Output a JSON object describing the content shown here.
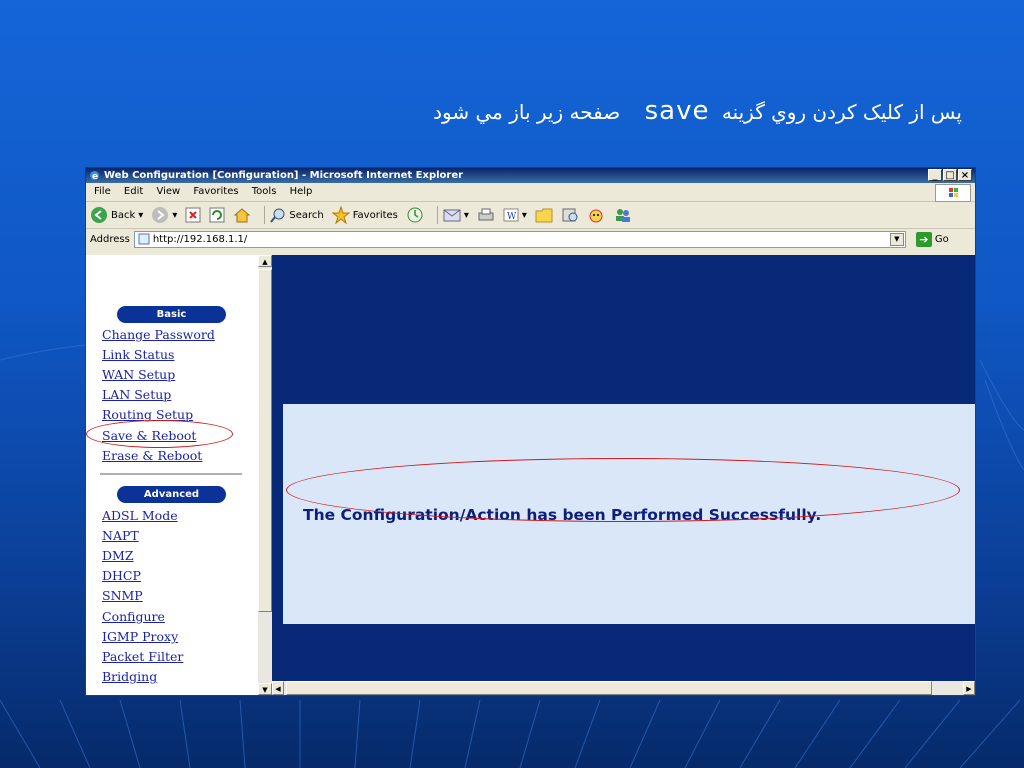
{
  "caption": {
    "prefix": "پس از كليک كردن روي گزينه",
    "keyword": "save",
    "suffix": "صفحه زير باز مي شود"
  },
  "window": {
    "title": "Web Configuration [Configuration] - Microsoft Internet Explorer",
    "controls": [
      "_",
      "□",
      "×"
    ]
  },
  "menu": [
    "File",
    "Edit",
    "View",
    "Favorites",
    "Tools",
    "Help"
  ],
  "toolbar": {
    "back": "Back",
    "search": "Search",
    "favorites": "Favorites"
  },
  "address": {
    "label": "Address",
    "url": "http://192.168.1.1/",
    "go": "Go"
  },
  "sidebar": {
    "basic_header": "Basic",
    "basic_items": [
      "Change Password",
      "Link Status",
      "WAN Setup",
      "LAN Setup",
      "Routing Setup",
      "Save & Reboot",
      "Erase & Reboot"
    ],
    "advanced_header": "Advanced",
    "advanced_items": [
      "ADSL Mode",
      "NAPT",
      "DMZ",
      "DHCP",
      "SNMP",
      "Configure",
      "IGMP Proxy",
      "Packet Filter",
      "Bridging"
    ]
  },
  "main": {
    "message": "The Configuration/Action has been Performed Successfully."
  },
  "colors": {
    "slide_bg": "#1565d8",
    "frame_bg": "#082878",
    "panel_bg": "#d9e7f9",
    "highlight": "#d01a1a",
    "link": "#1a22a8"
  }
}
